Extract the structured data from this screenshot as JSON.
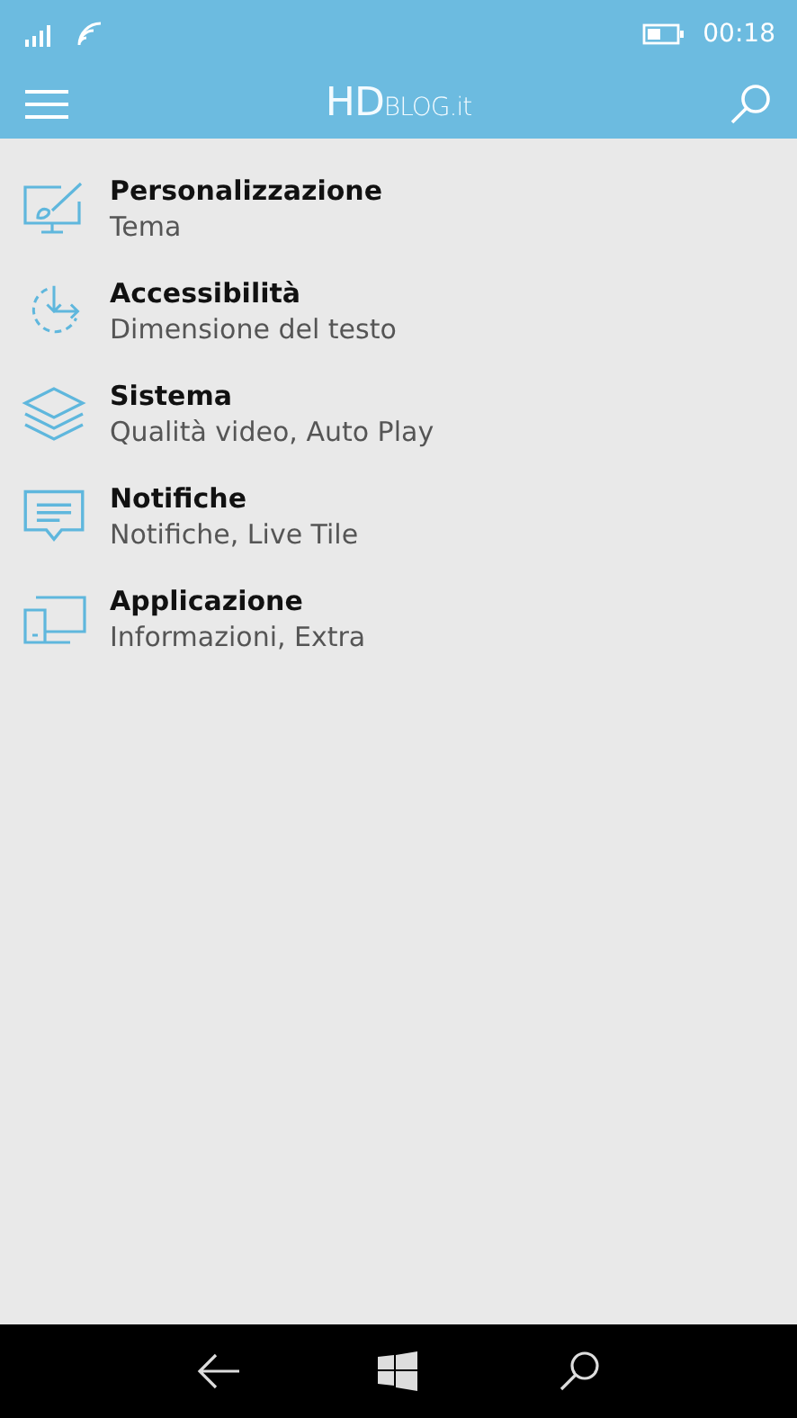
{
  "status_bar": {
    "time": "00:18"
  },
  "header": {
    "logo": {
      "strong": "HD",
      "light": "BLOG.it"
    }
  },
  "items": [
    {
      "kind": "paint",
      "title": "Personalizzazione",
      "subtitle": "Tema"
    },
    {
      "kind": "accessibility",
      "title": "Accessibilità",
      "subtitle": "Dimensione del testo"
    },
    {
      "kind": "layers",
      "title": "Sistema",
      "subtitle": "Qualità video, Auto Play"
    },
    {
      "kind": "message",
      "title": "Notifiche",
      "subtitle": "Notifiche, Live Tile"
    },
    {
      "kind": "devices",
      "title": "Applicazione",
      "subtitle": "Informazioni, Extra"
    }
  ]
}
